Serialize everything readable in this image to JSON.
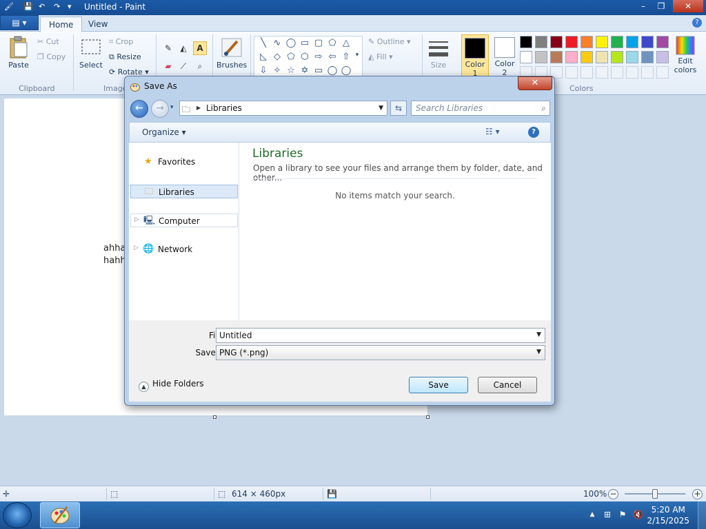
{
  "window": {
    "title": "Untitled - Paint"
  },
  "ribbon": {
    "tabs": [
      {
        "label": "Home"
      },
      {
        "label": "View"
      }
    ],
    "clipboard": {
      "paste": "Paste",
      "cut": "Cut",
      "copy": "Copy",
      "group": "Clipboard"
    },
    "image": {
      "select": "Select",
      "crop": "Crop",
      "resize": "Resize",
      "rotate": "Rotate",
      "group": "Image"
    },
    "tools": {
      "brushes": "Brushes"
    },
    "shapes": {
      "outline": "Outline",
      "fill": "Fill"
    },
    "size": "Size",
    "color1": {
      "label": "Color",
      "num": "1",
      "color": "#000000"
    },
    "color2": {
      "label": "Color",
      "num": "2",
      "color": "#ffffff"
    },
    "colors_group": "Colors",
    "edit_colors": {
      "line1": "Edit",
      "line2": "colors"
    },
    "palette_row1": [
      "#000000",
      "#7f7f7f",
      "#880015",
      "#ed1c24",
      "#ff7f27",
      "#fff200",
      "#22b14c",
      "#00a2e8",
      "#3f48cc",
      "#a349a4"
    ],
    "palette_row2": [
      "#ffffff",
      "#c3c3c3",
      "#b97a57",
      "#ffaec9",
      "#ffc90e",
      "#efe4b0",
      "#b5e61d",
      "#99d9ea",
      "#7092be",
      "#c8bfe7"
    ]
  },
  "canvas": {
    "line1": "ahha",
    "line2": "hahh"
  },
  "statusbar": {
    "dimensions": "614 × 460px",
    "zoom": "100%"
  },
  "taskbar": {
    "time": "5:20 AM",
    "date": "2/15/2025"
  },
  "dialog": {
    "title": "Save As",
    "address": "Libraries",
    "search_placeholder": "Search Libraries",
    "organize": "Organize",
    "nav": [
      {
        "label": "Favorites"
      },
      {
        "label": "Libraries"
      },
      {
        "label": "Computer"
      },
      {
        "label": "Network"
      }
    ],
    "content": {
      "title": "Libraries",
      "description": "Open a library to see your files and arrange them by folder, date, and other...",
      "empty": "No items match your search."
    },
    "file_name_label": "File name:",
    "file_name": "Untitled",
    "save_type_label": "Save as type:",
    "save_type": "PNG (*.png)",
    "hide_folders": "Hide Folders",
    "save": "Save",
    "cancel": "Cancel"
  }
}
